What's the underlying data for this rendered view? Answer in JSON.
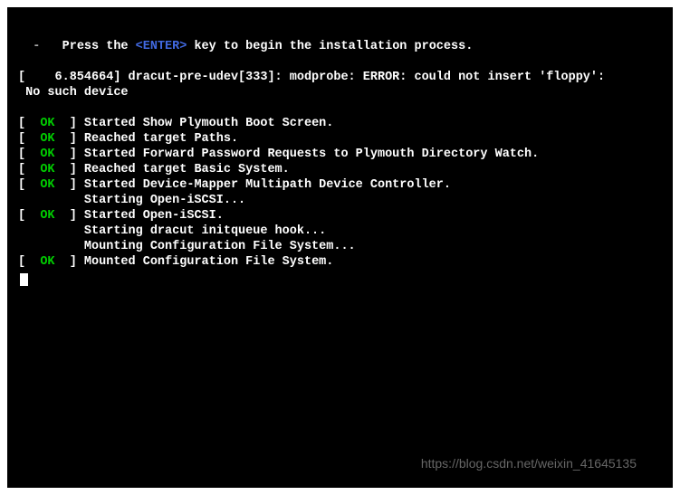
{
  "intro": {
    "dash": "  -  ",
    "press": " Press the ",
    "enter": "<ENTER>",
    "rest": " key to begin the installation process."
  },
  "error": {
    "line1": "[    6.854664] dracut-pre-udev[333]: modprobe: ERROR: could not insert 'floppy':",
    "line2": " No such device"
  },
  "ok_label": "OK",
  "brackets": {
    "open": "[  ",
    "close": "  ] "
  },
  "boot_lines": [
    {
      "type": "ok",
      "text": "Started Show Plymouth Boot Screen."
    },
    {
      "type": "ok",
      "text": "Reached target Paths."
    },
    {
      "type": "ok",
      "text": "Started Forward Password Requests to Plymouth Directory Watch."
    },
    {
      "type": "ok",
      "text": "Reached target Basic System."
    },
    {
      "type": "ok",
      "text": "Started Device-Mapper Multipath Device Controller."
    },
    {
      "type": "plain",
      "text": "         Starting Open-iSCSI..."
    },
    {
      "type": "ok",
      "text": "Started Open-iSCSI."
    },
    {
      "type": "plain",
      "text": "         Starting dracut initqueue hook..."
    },
    {
      "type": "plain",
      "text": "         Mounting Configuration File System..."
    },
    {
      "type": "ok",
      "text": "Mounted Configuration File System."
    }
  ],
  "watermark": "https://blog.csdn.net/weixin_41645135"
}
